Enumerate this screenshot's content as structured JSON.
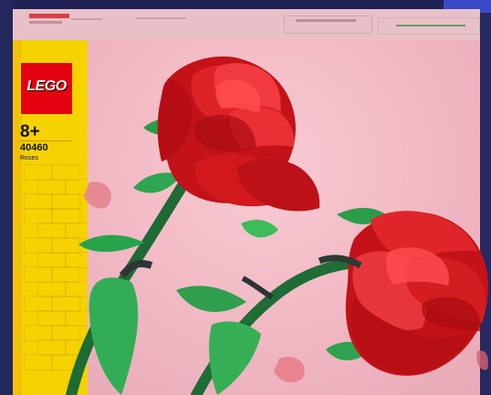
{
  "box": {
    "brand": "LEGO",
    "age": "8+",
    "set_number": "40460",
    "set_name": "Roses"
  },
  "colors": {
    "frame": "#25285a",
    "pink_background": "#f3bcc7",
    "yellow_panel": "#f5d200",
    "logo_red": "#e3000f",
    "rose_red": "#d1181c",
    "leaf_green": "#33a64e",
    "stem_green": "#1d6b33"
  },
  "icons": {
    "logo": "lego-logo-icon",
    "flower": "rose-icon"
  }
}
